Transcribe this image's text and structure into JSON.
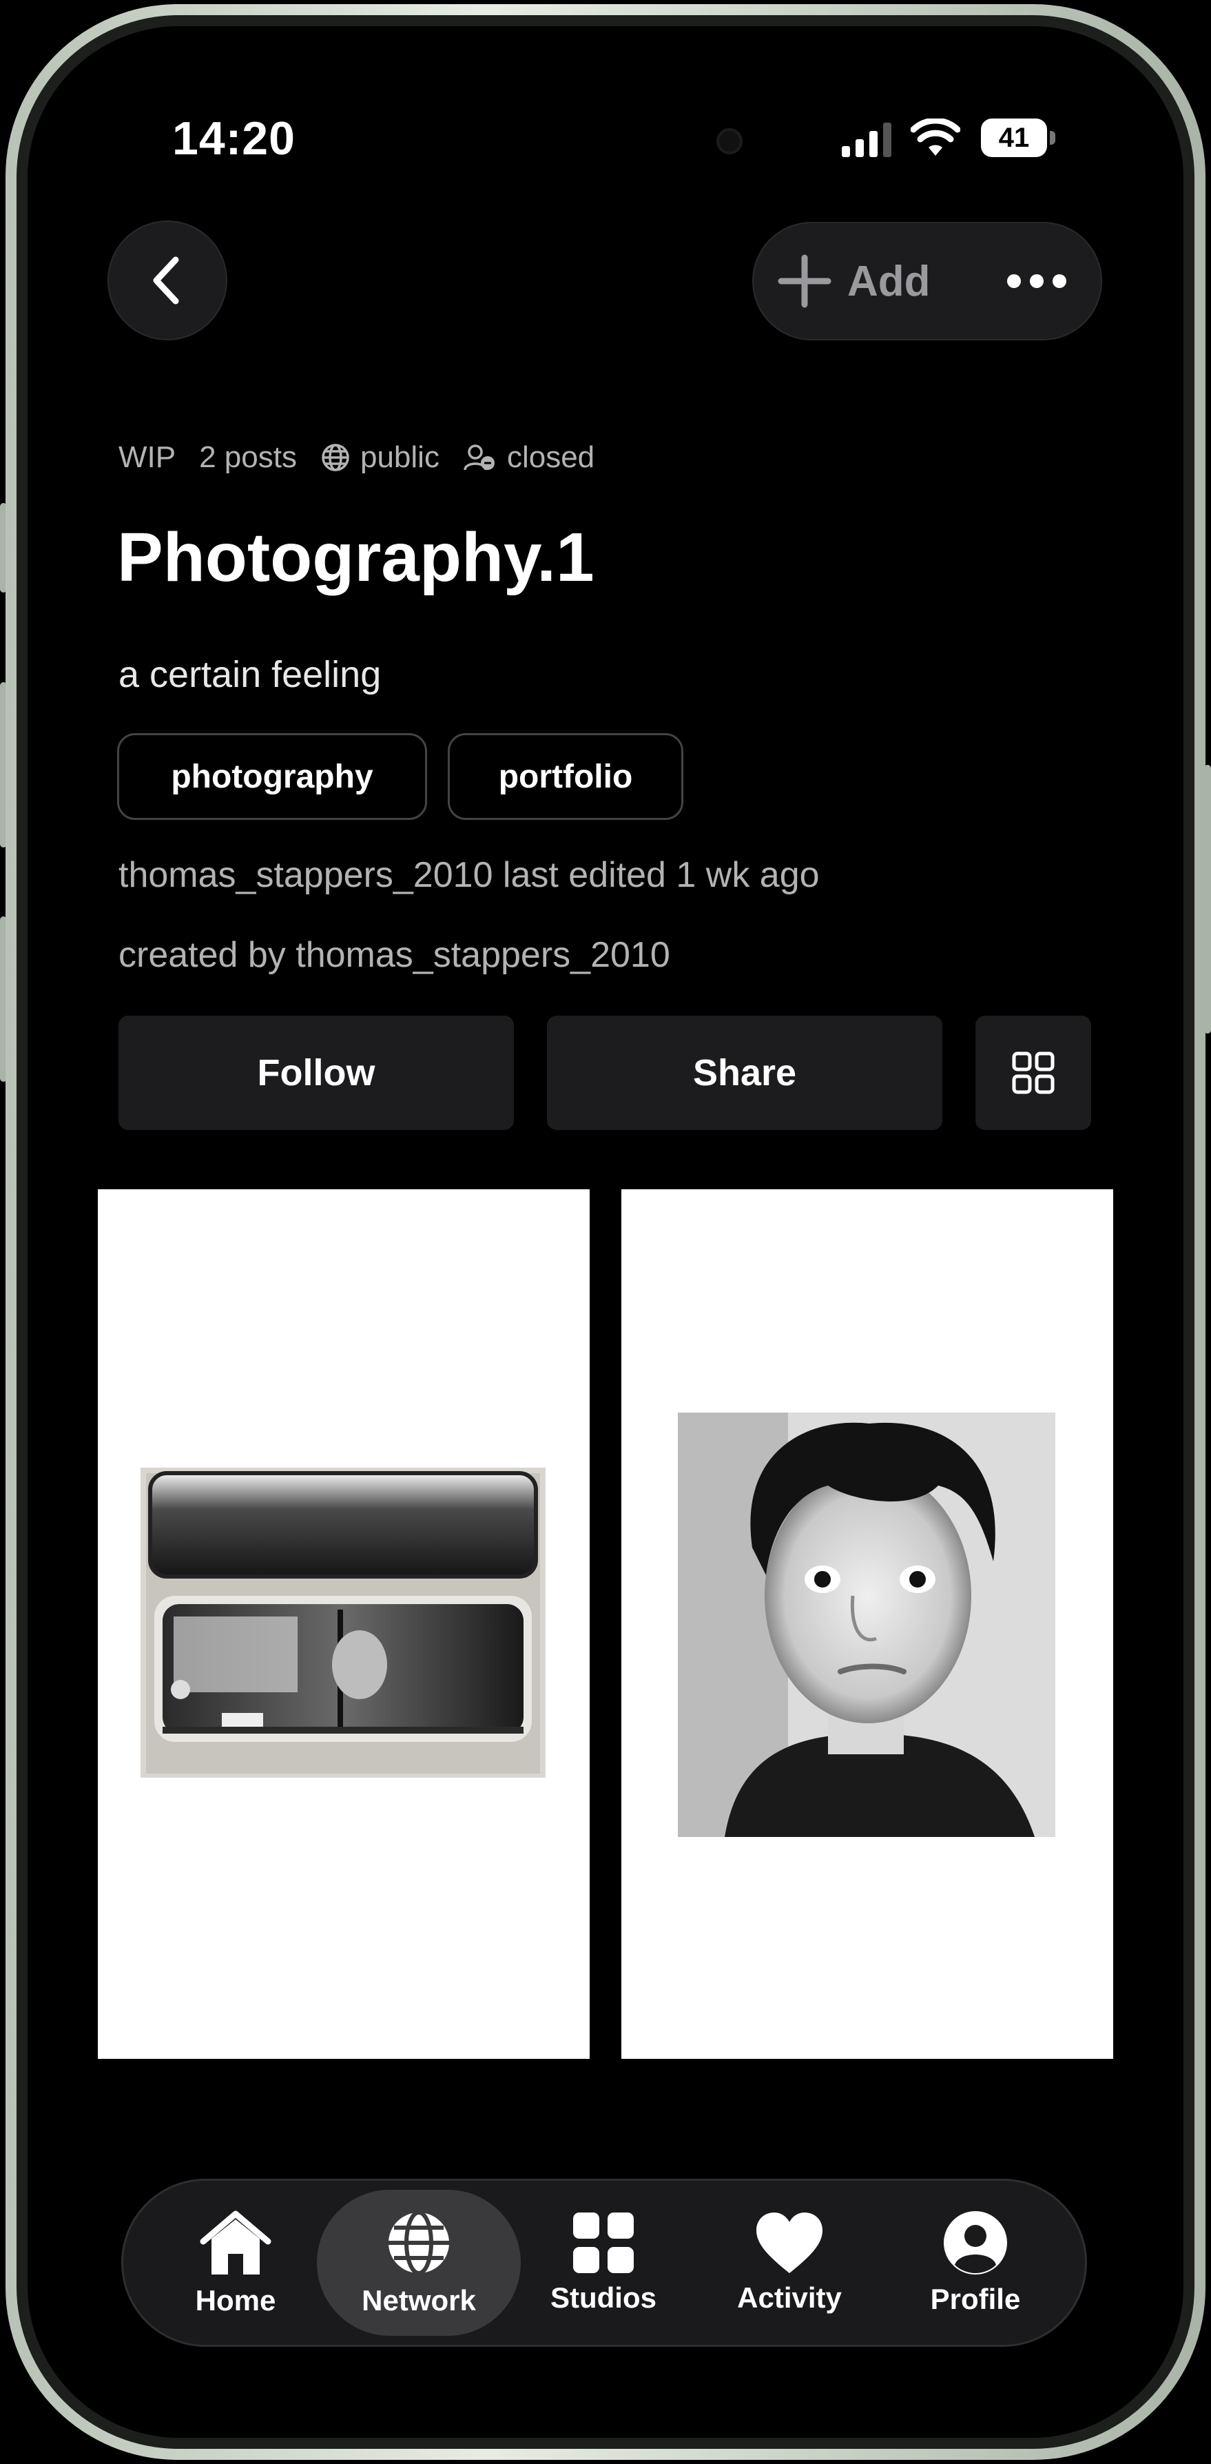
{
  "status_bar": {
    "time": "14:20",
    "battery": "41",
    "icons": [
      "camera-dot-icon",
      "cellular-signal-icon",
      "wifi-icon",
      "battery-icon"
    ]
  },
  "header": {
    "back_icon": "chevron-left-icon",
    "add_label": "Add",
    "add_icon": "plus-icon",
    "more_icon": "more-dots-icon"
  },
  "collection": {
    "status": "WIP",
    "post_count": "2 posts",
    "visibility": "public",
    "visibility_icon": "globe-icon",
    "membership": "closed",
    "membership_icon": "closed-group-icon",
    "title": "Photography.1",
    "description": "a certain feeling",
    "tags": [
      {
        "label": "photography"
      },
      {
        "label": "portfolio"
      }
    ],
    "last_edited": "thomas_stappers_2010 last edited 1 wk ago",
    "created_by": "created by thomas_stappers_2010"
  },
  "actions": {
    "follow_label": "Follow",
    "share_label": "Share",
    "layout_icon": "grid-view-icon"
  },
  "posts": [
    {
      "name": "photo-train-window",
      "tone": "monochrome"
    },
    {
      "name": "photo-boy-portrait",
      "tone": "monochrome"
    }
  ],
  "bottom_nav": {
    "active": "Network",
    "items": [
      {
        "label": "Home",
        "icon": "home-icon"
      },
      {
        "label": "Network",
        "icon": "globe-icon"
      },
      {
        "label": "Studios",
        "icon": "studios-grid-icon"
      },
      {
        "label": "Activity",
        "icon": "heart-icon"
      },
      {
        "label": "Profile",
        "icon": "profile-icon"
      }
    ]
  },
  "colors": {
    "background": "#000000",
    "surface": "#1c1c1e",
    "text_primary": "#ffffff",
    "text_secondary": "#b3b3b3",
    "frame": "#c8d0c6"
  }
}
